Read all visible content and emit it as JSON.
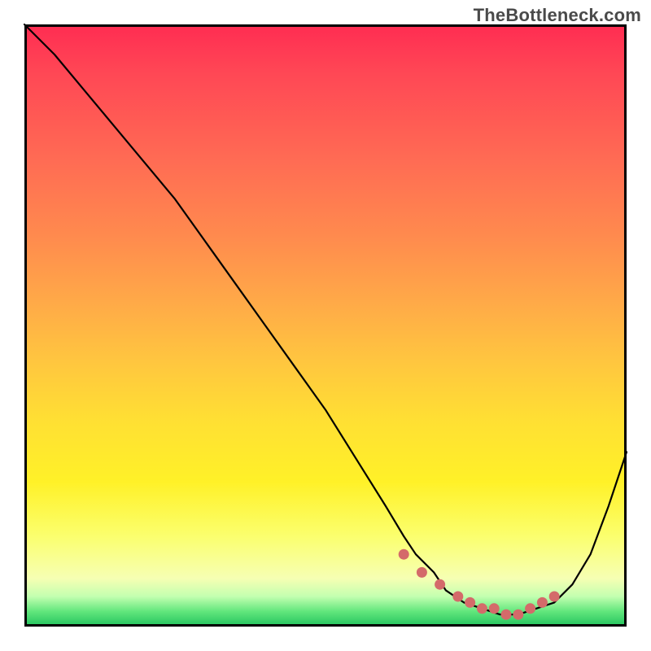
{
  "watermark": "TheBottleneck.com",
  "colors": {
    "frame": "#000000",
    "curve": "#000000",
    "marker": "#d46a6a"
  },
  "chart_data": {
    "type": "line",
    "title": "",
    "xlabel": "",
    "ylabel": "",
    "xlim": [
      0,
      100
    ],
    "ylim": [
      0,
      100
    ],
    "grid": false,
    "legend": false,
    "series": [
      {
        "name": "bottleneck-curve",
        "x": [
          0,
          5,
          10,
          15,
          20,
          25,
          30,
          35,
          40,
          45,
          50,
          55,
          60,
          63,
          65,
          68,
          70,
          73,
          76,
          79,
          82,
          85,
          88,
          91,
          94,
          97,
          100
        ],
        "y": [
          100,
          95,
          89,
          83,
          77,
          71,
          64,
          57,
          50,
          43,
          36,
          28,
          20,
          15,
          12,
          9,
          6,
          4,
          3,
          2,
          2,
          3,
          4,
          7,
          12,
          20,
          29
        ]
      }
    ],
    "markers": {
      "name": "highlight-region",
      "x": [
        63,
        66,
        69,
        72,
        74,
        76,
        78,
        80,
        82,
        84,
        86,
        88
      ],
      "y": [
        12,
        9,
        7,
        5,
        4,
        3,
        3,
        2,
        2,
        3,
        4,
        5
      ]
    }
  }
}
